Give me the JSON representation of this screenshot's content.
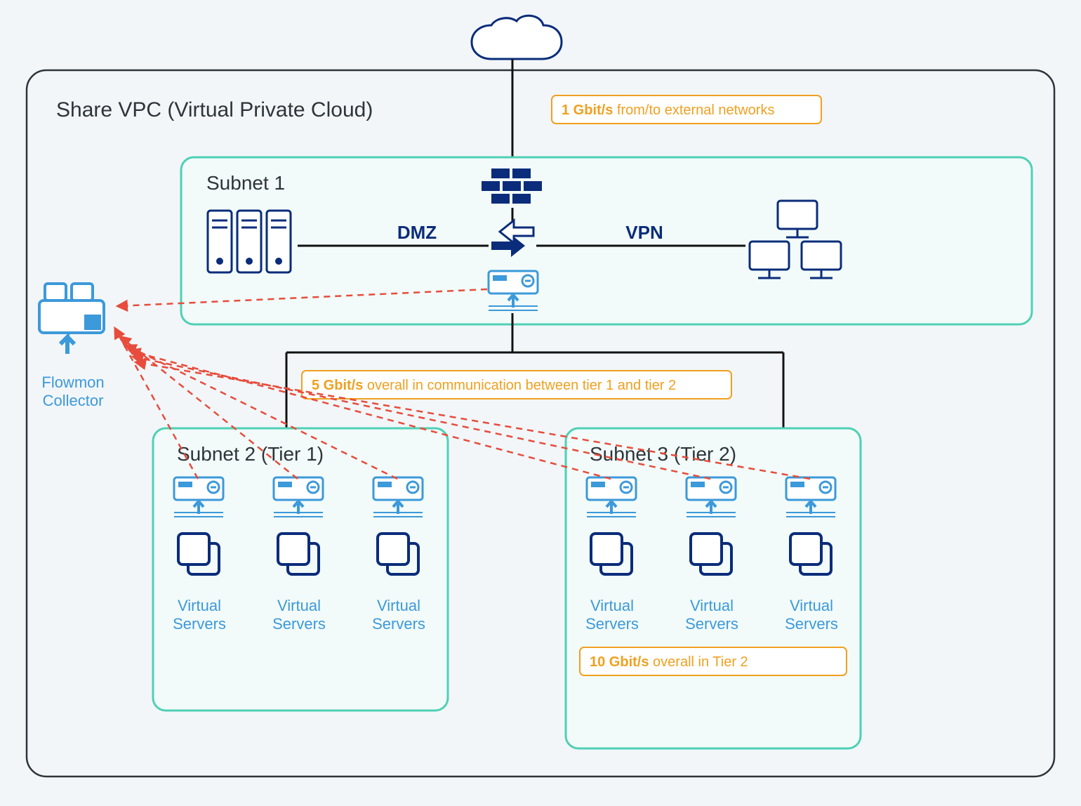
{
  "vpc_title": "Share VPC (Virtual Private Cloud)",
  "subnets": {
    "s1": "Subnet 1",
    "s2": "Subnet 2 (Tier 1)",
    "s3": "Subnet 3 (Tier 2)"
  },
  "labels": {
    "dmz": "DMZ",
    "vpn": "VPN",
    "vs": "Virtual",
    "vs2": "Servers",
    "col1": "Flowmon",
    "col2": "Collector"
  },
  "badges": {
    "b1_bold": "1 Gbit/s",
    "b1_rest": " from/to external networks",
    "b2_bold": "5 Gbit/s",
    "b2_rest": " overall in communication between tier 1 and tier 2",
    "b3_bold": "10 Gbit/s",
    "b3_rest": " overall in Tier 2"
  }
}
